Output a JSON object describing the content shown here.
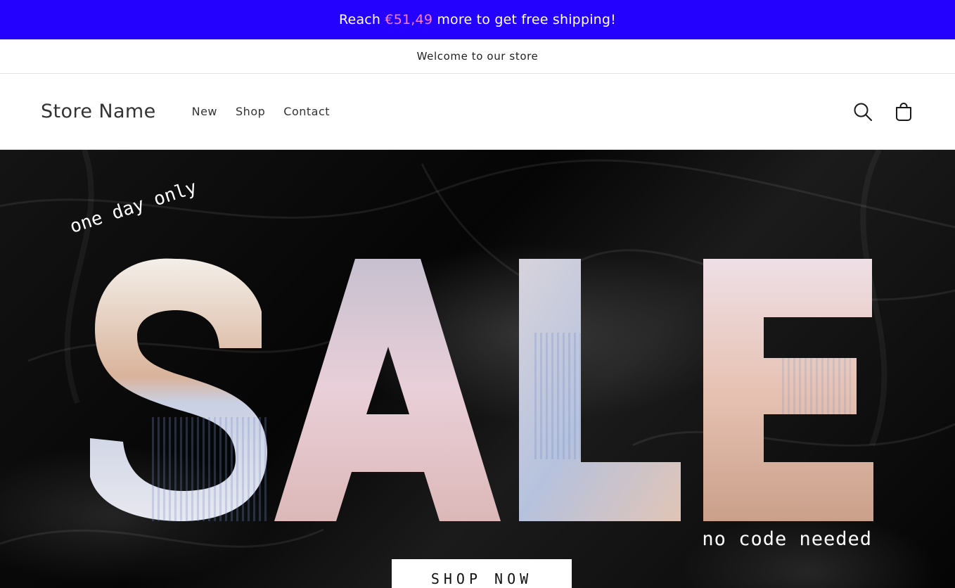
{
  "announcement": {
    "prefix": "Reach ",
    "amount": "€51,49",
    "suffix": " more to get free shipping!"
  },
  "welcome": "Welcome to our store",
  "header": {
    "store_name": "Store Name",
    "nav": [
      "New",
      "Shop",
      "Contact"
    ]
  },
  "hero": {
    "tagline_top": "one day only",
    "headline": "SALE",
    "tagline_bottom": "no code needed",
    "cta": "SHOP NOW"
  },
  "colors": {
    "announcement_bg": "#2400ff",
    "amount_accent": "#ff7ad9"
  }
}
